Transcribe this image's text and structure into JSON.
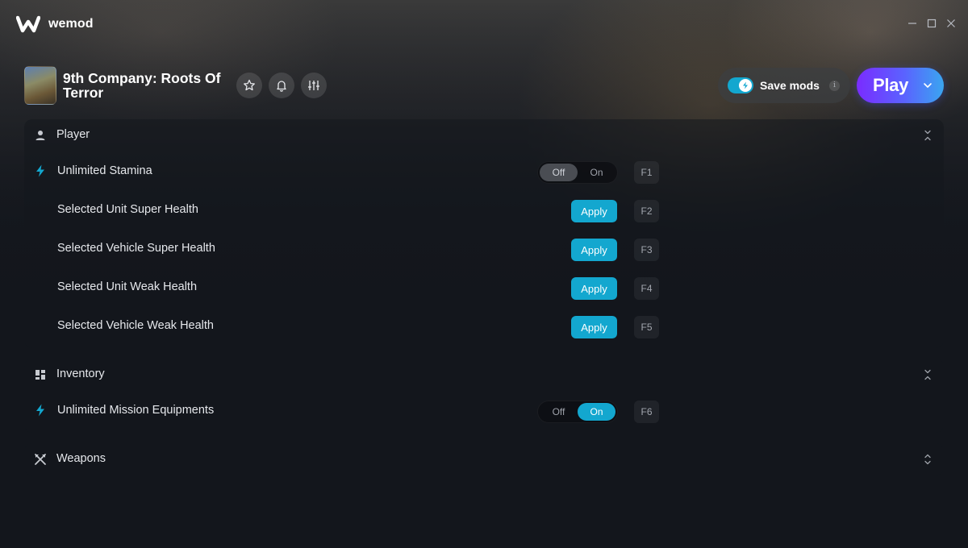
{
  "app": {
    "name": "wemod"
  },
  "window_controls": {
    "minimize_icon": "minimize-icon",
    "maximize_icon": "maximize-icon",
    "close_icon": "close-icon"
  },
  "game": {
    "title": "9th Company: Roots Of Terror",
    "header_icons": [
      "star-icon",
      "bell-icon",
      "sliders-icon"
    ],
    "save_mods": {
      "label": "Save mods",
      "enabled": true,
      "info": "i"
    },
    "play": {
      "label": "Play"
    }
  },
  "colors": {
    "accent": "#13a7cf",
    "play_gradient_start": "#7a2cff",
    "play_gradient_end": "#3aa6f0",
    "background": "#13161c"
  },
  "sections": [
    {
      "label": "Player",
      "icon": "person-icon",
      "mods": [
        {
          "label": "Unlimited Stamina",
          "type": "toggle",
          "value": "Off",
          "off_label": "Off",
          "on_label": "On",
          "hotkey": "F1",
          "icon": "bolt-icon"
        },
        {
          "label": "Selected Unit Super Health",
          "type": "button",
          "button_label": "Apply",
          "hotkey": "F2"
        },
        {
          "label": "Selected Vehicle Super Health",
          "type": "button",
          "button_label": "Apply",
          "hotkey": "F3"
        },
        {
          "label": "Selected Unit Weak Health",
          "type": "button",
          "button_label": "Apply",
          "hotkey": "F4"
        },
        {
          "label": "Selected Vehicle Weak Health",
          "type": "button",
          "button_label": "Apply",
          "hotkey": "F5"
        }
      ]
    },
    {
      "label": "Inventory",
      "icon": "grid-icon",
      "mods": [
        {
          "label": "Unlimited Mission Equipments",
          "type": "toggle",
          "value": "On",
          "off_label": "Off",
          "on_label": "On",
          "hotkey": "F6",
          "icon": "bolt-icon"
        }
      ]
    },
    {
      "label": "Weapons",
      "icon": "crossed-swords-icon",
      "mods": []
    }
  ]
}
